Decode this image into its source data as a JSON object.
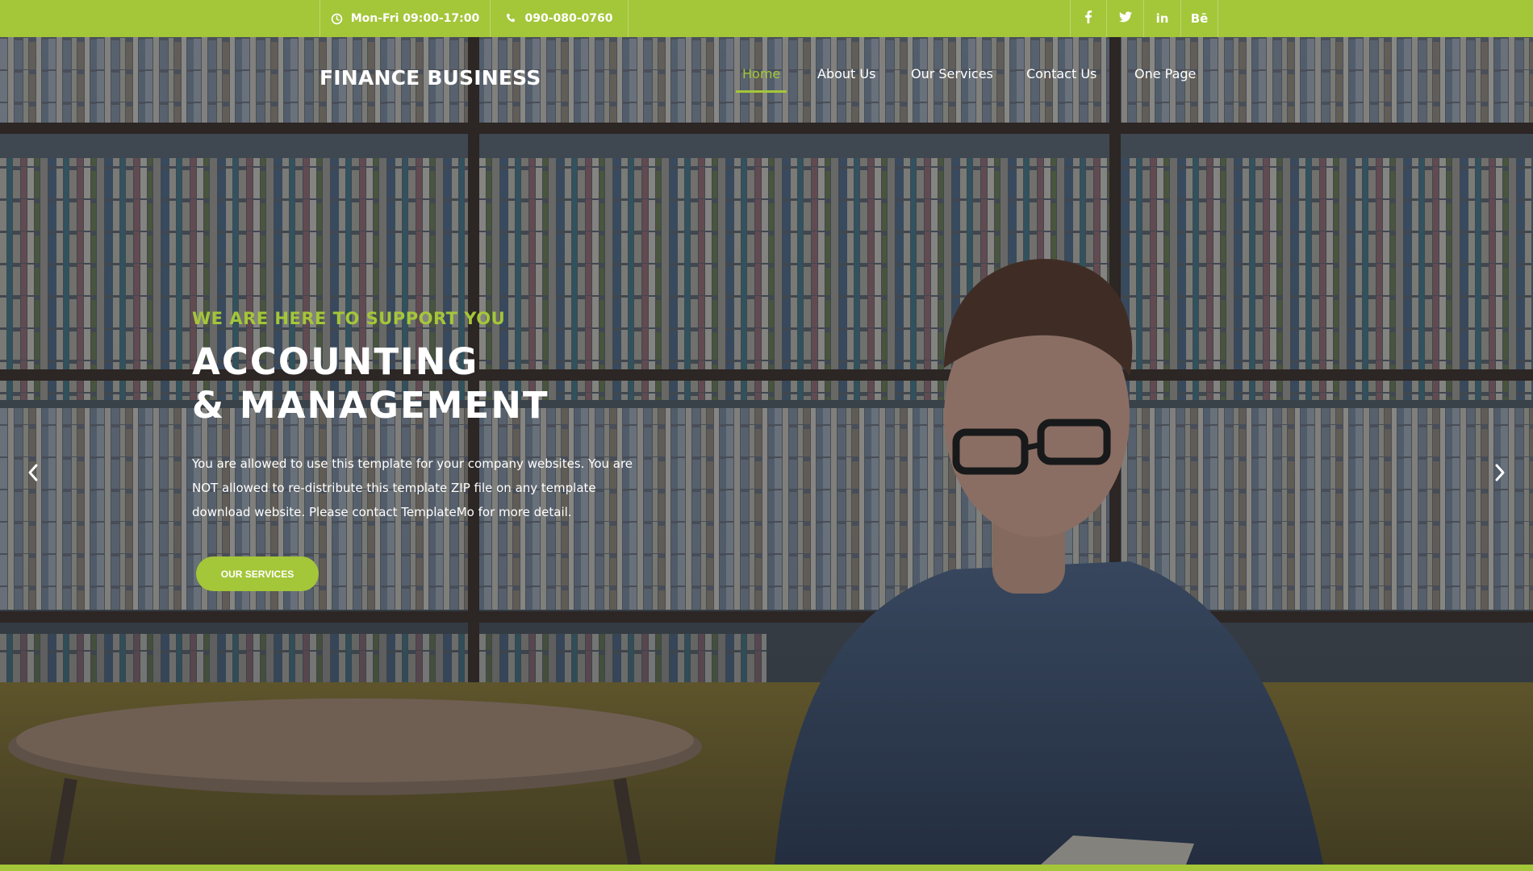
{
  "topbar": {
    "hours": "Mon-Fri 09:00-17:00",
    "phone": "090-080-0760",
    "social": [
      "f",
      "twitter",
      "in",
      "Bē"
    ]
  },
  "brand": "FINANCE BUSINESS",
  "nav": [
    {
      "label": "Home",
      "active": true
    },
    {
      "label": "About Us",
      "active": false
    },
    {
      "label": "Our Services",
      "active": false
    },
    {
      "label": "Contact Us",
      "active": false
    },
    {
      "label": "One Page",
      "active": false
    }
  ],
  "hero": {
    "eyebrow": "WE ARE HERE TO SUPPORT YOU",
    "headline_line1": "ACCOUNTING",
    "headline_line2": "& MANAGEMENT",
    "description_line1": "You are allowed to use this template for your company websites. You are",
    "description_line2": "NOT allowed to re-distribute this template ZIP file on any template",
    "description_line3": "download website. Please contact TemplateMo for more detail.",
    "cta_label": "OUR SERVICES",
    "prev_icon": "chevron-left-icon",
    "next_icon": "chevron-right-icon"
  },
  "colors": {
    "accent": "#a4c639",
    "text": "#ffffff"
  }
}
